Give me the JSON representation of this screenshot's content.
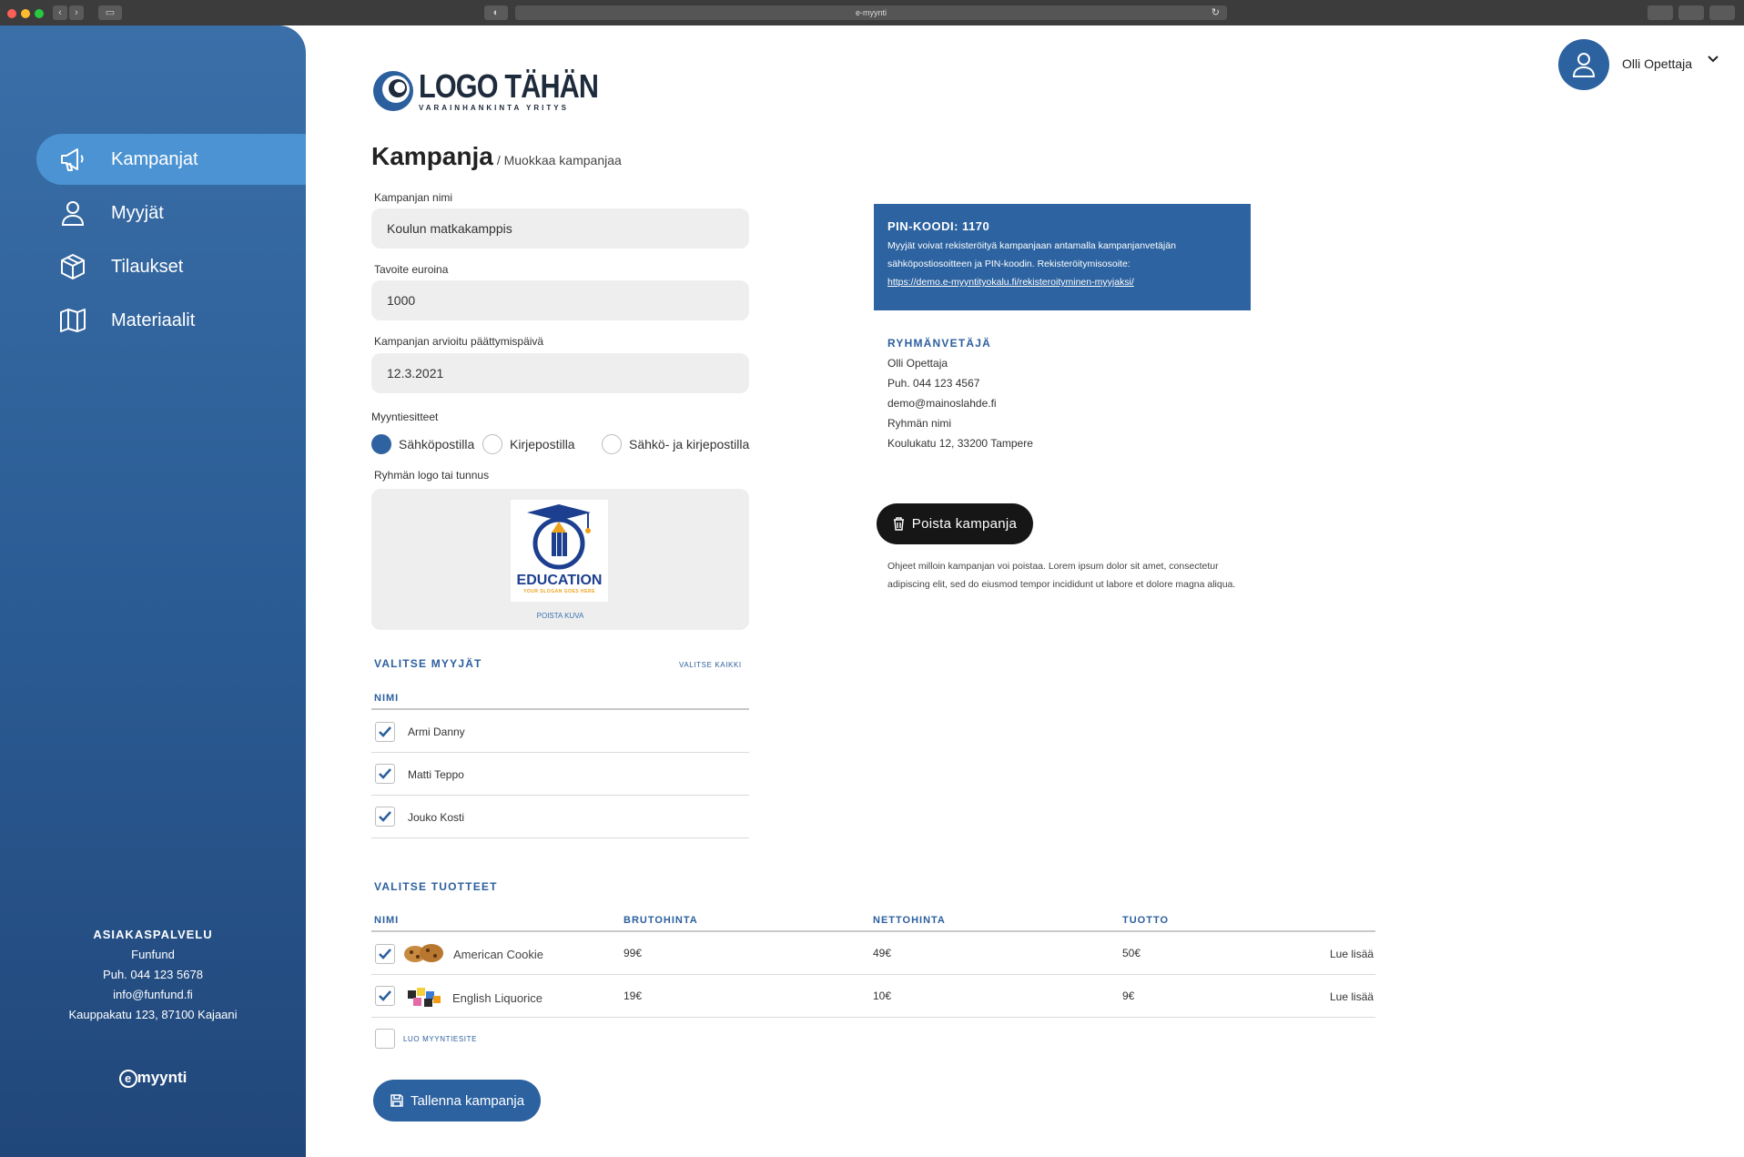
{
  "browser": {
    "url": "e-myynti"
  },
  "sidebar": {
    "items": [
      {
        "label": "Kampanjat",
        "icon": "megaphone-icon"
      },
      {
        "label": "Myyjät",
        "icon": "user-icon"
      },
      {
        "label": "Tilaukset",
        "icon": "box-icon"
      },
      {
        "label": "Materiaalit",
        "icon": "map-icon"
      }
    ],
    "support": {
      "heading": "ASIAKASPALVELU",
      "company": "Funfund",
      "phone": "Puh. 044 123 5678",
      "email": "info@funfund.fi",
      "address": "Kauppakatu 123, 87100 Kajaani"
    },
    "brand": "myynti"
  },
  "header": {
    "user_name": "Olli Opettaja"
  },
  "logo": {
    "title": "LOGO TÄHÄN",
    "subtitle": "VARAINHANKINTA YRITYS"
  },
  "page": {
    "title": "Kampanja",
    "breadcrumb": "/ Muokkaa kampanjaa"
  },
  "form": {
    "name_label": "Kampanjan nimi",
    "name_value": "Koulun matkakamppis",
    "goal_label": "Tavoite euroina",
    "goal_value": "1000",
    "end_label": "Kampanjan arvioitu päättymispäivä",
    "end_value": "12.3.2021",
    "brochure_label": "Myyntiesitteet",
    "brochure_options": [
      {
        "label": "Sähköpostilla",
        "selected": true
      },
      {
        "label": "Kirjepostilla",
        "selected": false
      },
      {
        "label": "Sähkö- ja kirjepostilla",
        "selected": false
      }
    ],
    "logo_label": "Ryhmän logo tai tunnus",
    "logo_image_text": "EDUCATION",
    "logo_image_slogan": "YOUR SLOGAN GOES HERE",
    "remove_image": "POISTA KUVA"
  },
  "sellers": {
    "heading": "VALITSE MYYJÄT",
    "select_all": "VALITSE KAIKKI",
    "col_name": "NIMI",
    "rows": [
      {
        "name": "Armi Danny",
        "checked": true
      },
      {
        "name": "Matti Teppo",
        "checked": true
      },
      {
        "name": "Jouko Kosti",
        "checked": true
      }
    ]
  },
  "products": {
    "heading": "VALITSE TUOTTEET",
    "columns": [
      "NIMI",
      "BRUTOHINTA",
      "NETTOHINTA",
      "TUOTTO"
    ],
    "rows": [
      {
        "name": "American Cookie",
        "gross": "99€",
        "net": "49€",
        "profit": "50€",
        "more": "Lue lisää",
        "checked": true
      },
      {
        "name": "English Liquorice",
        "gross": "19€",
        "net": "10€",
        "profit": "9€",
        "more": "Lue lisää",
        "checked": true
      }
    ],
    "create_brochure": "LUO MYYNTIESITE"
  },
  "actions": {
    "save_label": "Tallenna kampanja",
    "delete_label": "Poista kampanja",
    "delete_note": "Ohjeet milloin kampanjan voi poistaa. Lorem ipsum dolor sit amet, consectetur adipiscing elit, sed do eiusmod tempor incididunt ut labore et dolore magna aliqua."
  },
  "pin": {
    "heading": "PIN-KOODI: 1170",
    "text": "Myyjät voivat rekisteröityä kampanjaan antamalla kampanjanvetäjän sähköpostiosoitteen ja PIN-koodin. Rekisteröitymisosoite:",
    "link": "https://demo.e-myyntityokalu.fi/rekisteroityminen-myyjaksi/"
  },
  "leader": {
    "heading": "RYHMÄNVETÄJÄ",
    "name": "Olli Opettaja",
    "phone": "Puh. 044 123 4567",
    "email": "demo@mainoslahde.fi",
    "group": "Ryhmän nimi",
    "address": "Koulukatu 12, 33200 Tampere"
  },
  "colors": {
    "sidebar": "#2a5a92",
    "active": "#4b93d3",
    "primary": "#2c62a0",
    "dark_button": "#161616"
  }
}
